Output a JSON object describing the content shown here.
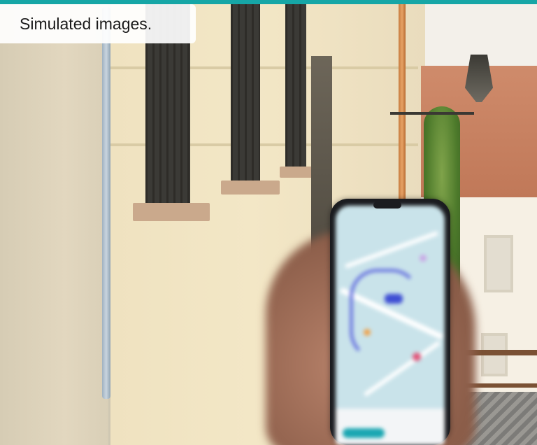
{
  "caption": {
    "text": "Simulated images."
  },
  "colors": {
    "accent": "#16a6a6",
    "caption_bg": "#ffffff",
    "caption_text": "#1a1a1a"
  }
}
